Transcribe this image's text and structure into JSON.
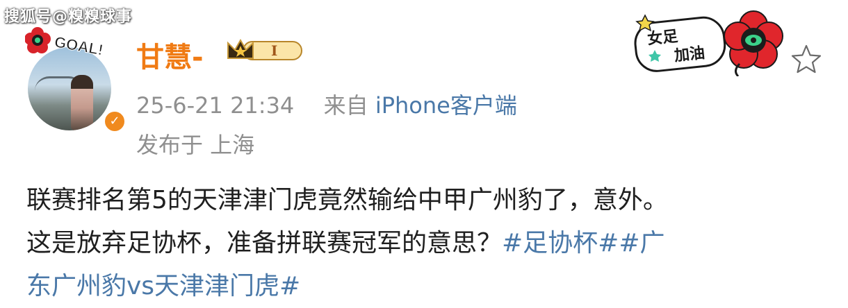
{
  "watermark": "搜狐号@糗糗球事",
  "post": {
    "avatar_goal_text": "GOAL!",
    "username": "甘慧-",
    "vip_level": "I",
    "timestamp": "25-6-21 21:34",
    "source_prefix": "来自",
    "source": "iPhone客户端",
    "location": "发布于 上海",
    "text_line1": "联赛排名第5的天津津门虎竟然输给中甲广州豹了，意外。",
    "text_line2_plain": "这是放弃足协杯，准备拼联赛冠军的意思？",
    "text_line2_tag": "#足协杯##广",
    "text_line3_tag": "东广州豹vs天津津门虎#"
  },
  "sticker": {
    "line1": "女足",
    "line2": "加油"
  },
  "colors": {
    "username": "#f07b14",
    "link": "#4a78a8",
    "meta": "#8f8f8f",
    "verified": "#f08a1e"
  },
  "icons": [
    "verified-icon",
    "vip-crown-icon",
    "favorite-star-icon",
    "flower-sticker-icon"
  ]
}
